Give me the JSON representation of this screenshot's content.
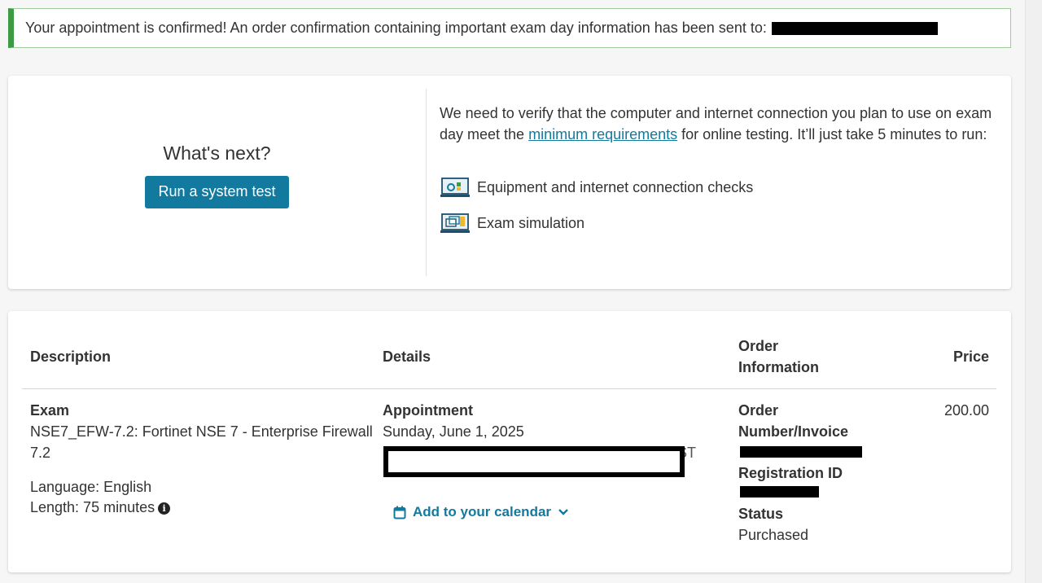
{
  "banner": {
    "message": "Your appointment is confirmed! An order confirmation containing important exam day information has been sent to:"
  },
  "next": {
    "title": "What's next?",
    "button": "Run a system test",
    "intro_before": "We need to verify that the computer and internet connection you plan to use on exam day meet the ",
    "intro_link": "minimum requirements",
    "intro_after": " for online testing. It’ll just take 5 minutes to run:",
    "checks": [
      {
        "label": "Equipment and internet connection checks",
        "icon": "equipment-check-icon"
      },
      {
        "label": "Exam simulation",
        "icon": "exam-simulation-icon"
      }
    ]
  },
  "order": {
    "headers": {
      "description": "Description",
      "details": "Details",
      "order_info": "Order Information",
      "price": "Price"
    },
    "exam_label": "Exam",
    "exam_name": "NSE7_EFW-7.2: Fortinet NSE 7 - Enterprise Firewall 7.2",
    "language": "Language: English",
    "length": "Length: 75 minutes",
    "appointment_label": "Appointment",
    "appointment_date": "Sunday, June 1, 2025",
    "checkin_visible": "AST",
    "calendar_link": "Add to your calendar",
    "order_number_label": "Order Number/Invoice",
    "registration_label": "Registration ID",
    "status_label": "Status",
    "status_value": "Purchased",
    "price": "200.00"
  },
  "colors": {
    "accent": "#137a9f",
    "success_border": "#3e9a45",
    "redaction": "#000000"
  }
}
